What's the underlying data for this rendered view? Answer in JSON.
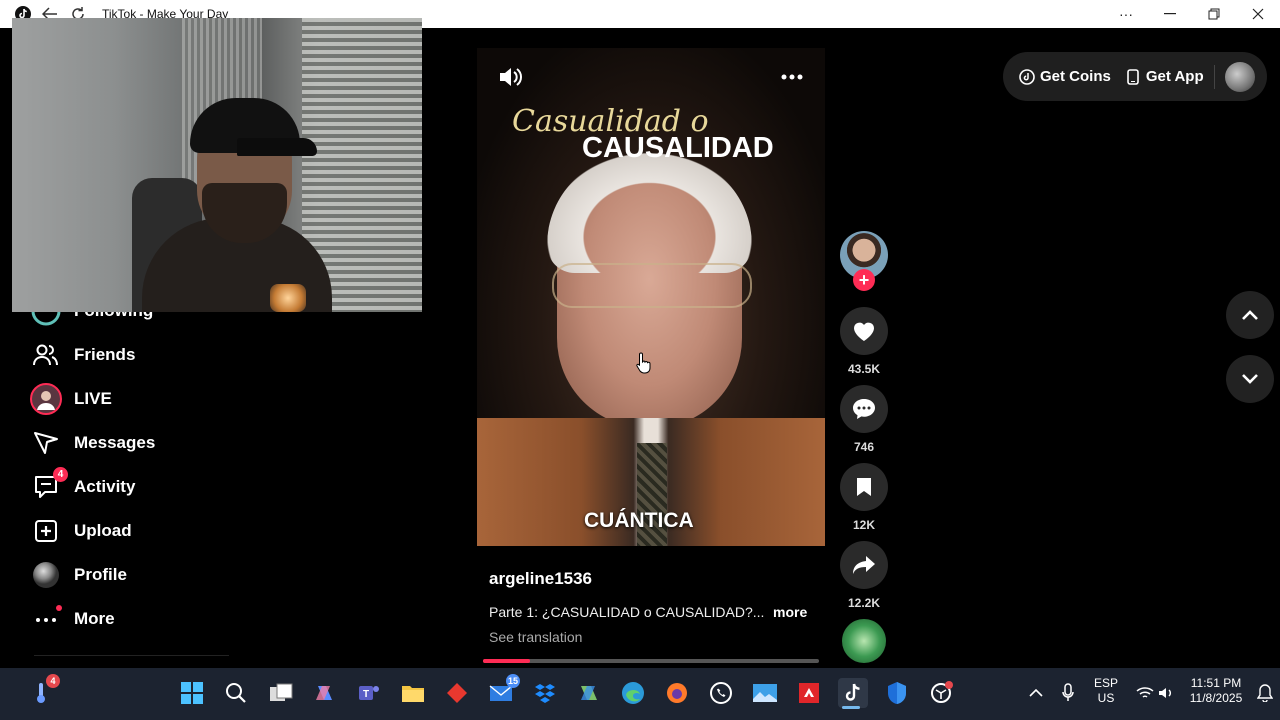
{
  "window": {
    "title": "TikTok - Make Your Day"
  },
  "sidebar": {
    "items": [
      {
        "label": "Following",
        "icon": "following-icon"
      },
      {
        "label": "Friends",
        "icon": "friends-icon"
      },
      {
        "label": "LIVE",
        "icon": "live-icon"
      },
      {
        "label": "Messages",
        "icon": "messages-icon"
      },
      {
        "label": "Activity",
        "icon": "activity-icon",
        "badge": "4"
      },
      {
        "label": "Upload",
        "icon": "upload-icon"
      },
      {
        "label": "Profile",
        "icon": "profile-icon"
      },
      {
        "label": "More",
        "icon": "more-icon"
      }
    ]
  },
  "video": {
    "overlay_line1": "Casualidad o",
    "overlay_line2": "CAUSALIDAD",
    "caption_word": "CUÁNTICA",
    "username": "argeline1536",
    "description": "Parte 1: ¿CASUALIDAD o CAUSALIDAD?...",
    "more_label": "more",
    "translation_label": "See translation",
    "progress": 0.14
  },
  "actions": {
    "likes": "43.5K",
    "comments": "746",
    "saves": "12K",
    "shares": "12.2K"
  },
  "topbar": {
    "get_coins": "Get Coins",
    "get_app": "Get App"
  },
  "taskbar": {
    "weather_badge": "4",
    "mail_badge": "15",
    "language_top": "ESP",
    "language_bottom": "US",
    "time": "11:51 PM",
    "date": "11/8/2025"
  },
  "colors": {
    "accent": "#fe2c55",
    "background": "#000000",
    "caption_gold": "#e8d89a",
    "taskbar": "#1c2330"
  }
}
